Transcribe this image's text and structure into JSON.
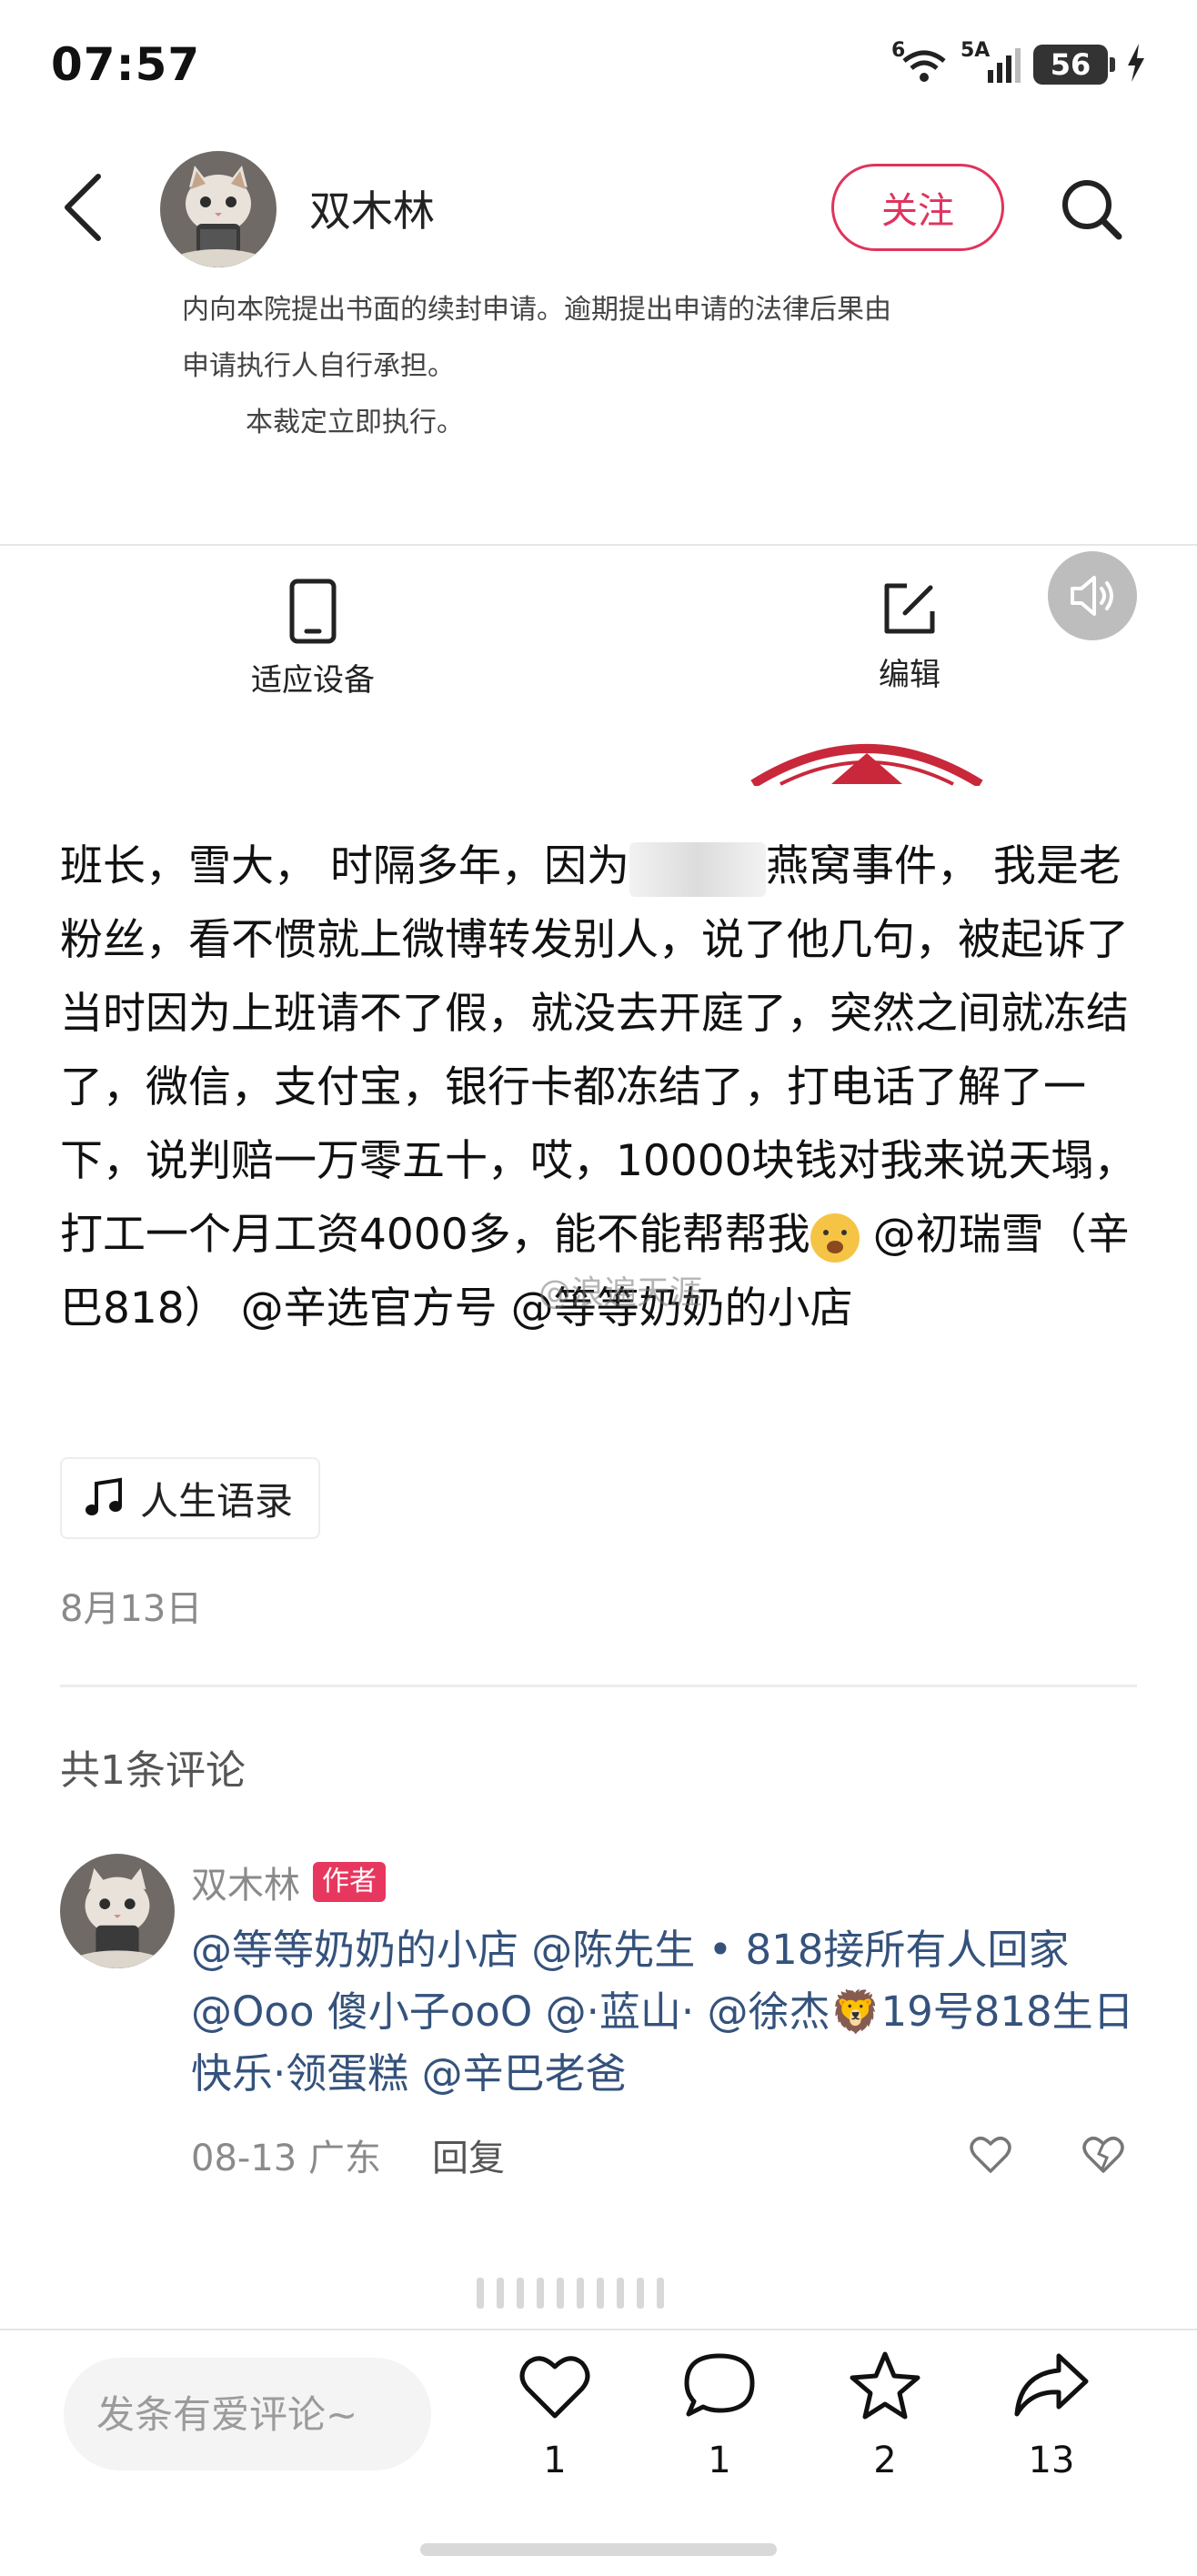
{
  "status_bar": {
    "time": "07:57",
    "network_label": "6",
    "signal_label": "5A",
    "battery_level": "56",
    "icons": [
      "wifi-icon",
      "signal-icon",
      "battery-icon",
      "charging-icon"
    ]
  },
  "header": {
    "author_name": "双木林",
    "follow_label": "关注",
    "icons": [
      "back-icon",
      "search-icon"
    ]
  },
  "document_excerpt": {
    "lines": [
      "内向本院提出书面的续封申请。逾期提出申请的法律后果由",
      "申请执行人自行承担。",
      "本裁定立即执行。"
    ]
  },
  "toolbar": {
    "fit_device_label": "适应设备",
    "edit_label": "编辑",
    "icons": [
      "phone-icon",
      "edit-icon",
      "volume-icon"
    ]
  },
  "post": {
    "text_part1": "班长，雪大， 时隔多年，因为",
    "text_part2": "燕窝事件， 我是老粉丝，看不惯就上微博转发别人，说了他几句，被起诉了 当时因为上班请不了假，就没去开庭了，突然之间就冻结了，微信，支付宝，银行卡都冻结了，打电话了解了一下，说判赔一万零五十，哎，10000块钱对我来说天塌，打工一个月工资4000多，能不能帮帮我",
    "mention1": "@初瑞雪（辛巴818）",
    "mention2": "@辛选官方号",
    "mention3": "@等等奶奶的小店",
    "watermark": "@浪遍天涯",
    "tag_label": "人生语录",
    "date": "8月13日"
  },
  "comments": {
    "count_label": "共1条评论",
    "items": [
      {
        "author": "双木林",
        "badge": "作者",
        "text": "@等等奶奶的小店 @陈先生 • 818接所有人回家 @Ooo 傻小子ooO @·蓝山· @徐杰🦁19号818生日快乐·领蛋糕 @辛巴老爸",
        "date_location": "08-13 广东",
        "reply_label": "回复"
      }
    ]
  },
  "bottom_bar": {
    "comment_placeholder": "发条有爱评论~",
    "like_count": "1",
    "comment_count": "1",
    "star_count": "2",
    "share_count": "13"
  },
  "colors": {
    "accent": "#e0335d",
    "mention_blue": "#34527c",
    "badge": "#e8375f",
    "muted": "#8a8a8a"
  }
}
